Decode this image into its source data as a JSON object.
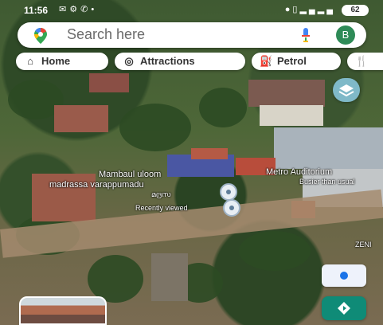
{
  "status_bar": {
    "time": "11:56",
    "battery": "62",
    "left_icons": [
      "email-icon",
      "settings-icon",
      "phone-icon",
      "dot-icon"
    ],
    "right_icons": [
      "location-icon",
      "vibrate-icon",
      "signal-icon",
      "signal-icon"
    ]
  },
  "search": {
    "placeholder": "Search here",
    "avatar_initial": "B",
    "avatar_color": "#2e8b57"
  },
  "chips": [
    {
      "label": "Home",
      "icon": "home-icon"
    },
    {
      "label": "Attractions",
      "icon": "camera-icon"
    },
    {
      "label": "Petrol",
      "icon": "fuel-icon"
    },
    {
      "label": "",
      "icon": "restaurant-icon"
    }
  ],
  "map_labels": {
    "place1_line1": "Mambaul uloom",
    "place1_line2": "madrassa varappumadu",
    "place1_line3": "മദ്രസ",
    "recently_viewed": "Recently viewed",
    "place2_line1": "Metro Auditorium",
    "place2_line2": "Busier than usual",
    "zen": "ZENI"
  },
  "colors": {
    "accent_blue": "#1a73e8",
    "directions_green": "#0f8b77",
    "layers_teal": "#7fb9c8"
  }
}
